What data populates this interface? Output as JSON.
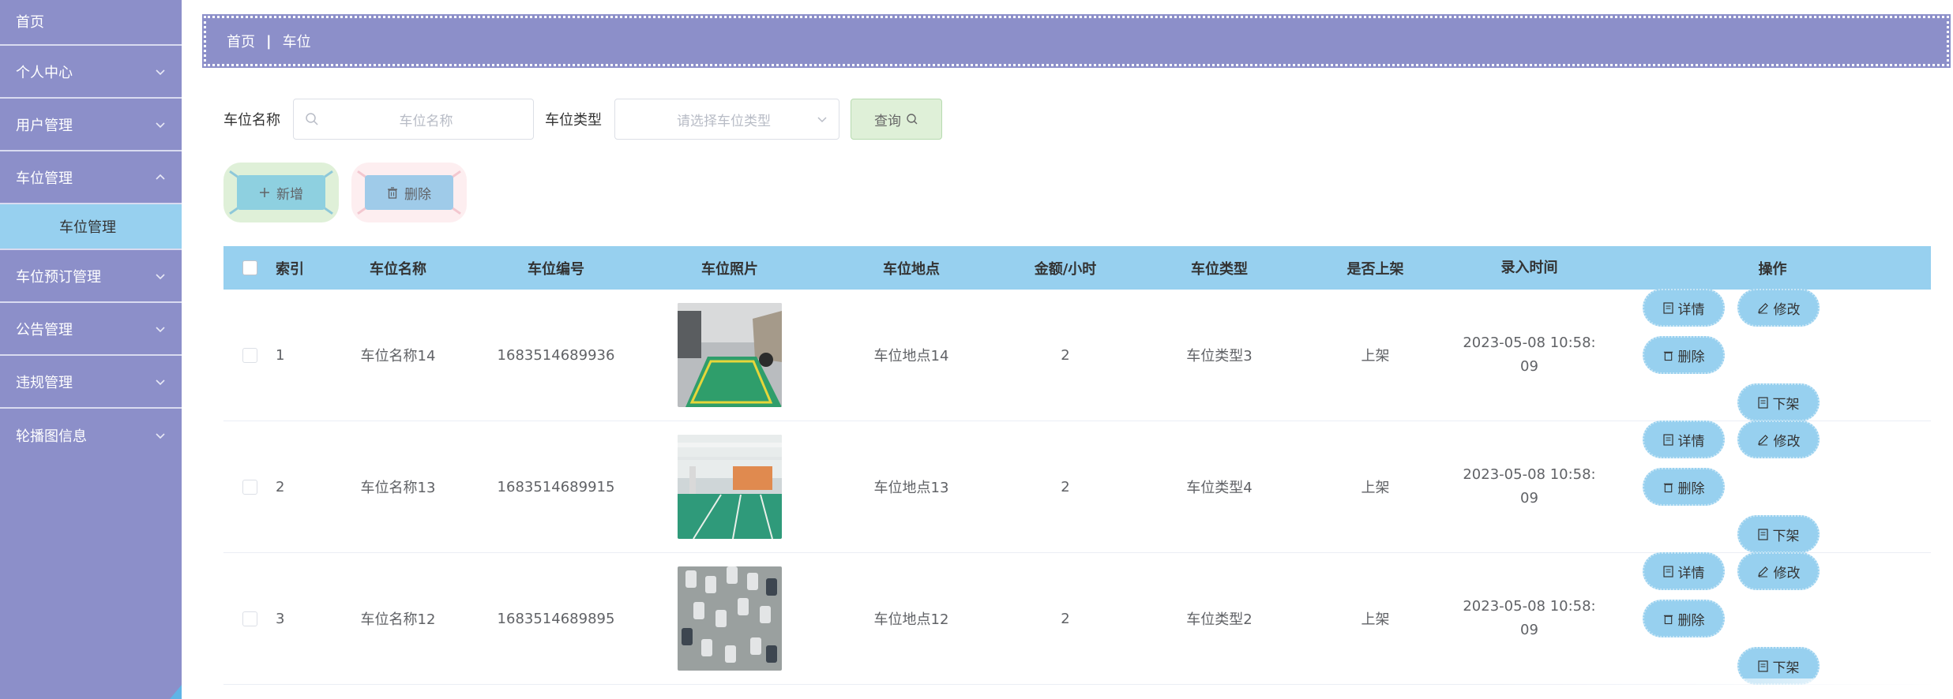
{
  "sidebar": {
    "items": [
      {
        "label": "首页"
      },
      {
        "label": "个人中心"
      },
      {
        "label": "用户管理"
      },
      {
        "label": "车位管理"
      },
      {
        "label": "车位预订管理"
      },
      {
        "label": "公告管理"
      },
      {
        "label": "违规管理"
      },
      {
        "label": "轮播图信息"
      }
    ],
    "submenu": {
      "label": "车位管理"
    }
  },
  "breadcrumb": {
    "home": "首页",
    "separator": "|",
    "current": "车位"
  },
  "search": {
    "name_label": "车位名称",
    "name_placeholder": "车位名称",
    "type_label": "车位类型",
    "type_placeholder": "请选择车位类型",
    "query_label": "查询"
  },
  "actions": {
    "add_label": "新增",
    "delete_label": "删除"
  },
  "table": {
    "columns": [
      "索引",
      "车位名称",
      "车位编号",
      "车位照片",
      "车位地点",
      "金额/小时",
      "车位类型",
      "是否上架",
      "录入时间",
      "操作"
    ],
    "rows": [
      {
        "index": "1",
        "name": "车位名称14",
        "number": "1683514689936",
        "location": "车位地点14",
        "amount": "2",
        "type": "车位类型3",
        "shelf": "上架",
        "time_line1": "2023-05-08 10:58:",
        "time_line2": "09"
      },
      {
        "index": "2",
        "name": "车位名称13",
        "number": "1683514689915",
        "location": "车位地点13",
        "amount": "2",
        "type": "车位类型4",
        "shelf": "上架",
        "time_line1": "2023-05-08 10:58:",
        "time_line2": "09"
      },
      {
        "index": "3",
        "name": "车位名称12",
        "number": "1683514689895",
        "location": "车位地点12",
        "amount": "2",
        "type": "车位类型2",
        "shelf": "上架",
        "time_line1": "2023-05-08 10:58:",
        "time_line2": "09"
      }
    ],
    "op_labels": {
      "detail": "详情",
      "edit": "修改",
      "delete": "删除",
      "unshelf": "下架"
    }
  },
  "colors": {
    "sidebar": "#8c8fc9",
    "header_row": "#97d0ef",
    "query_button": "#dff0d8"
  }
}
